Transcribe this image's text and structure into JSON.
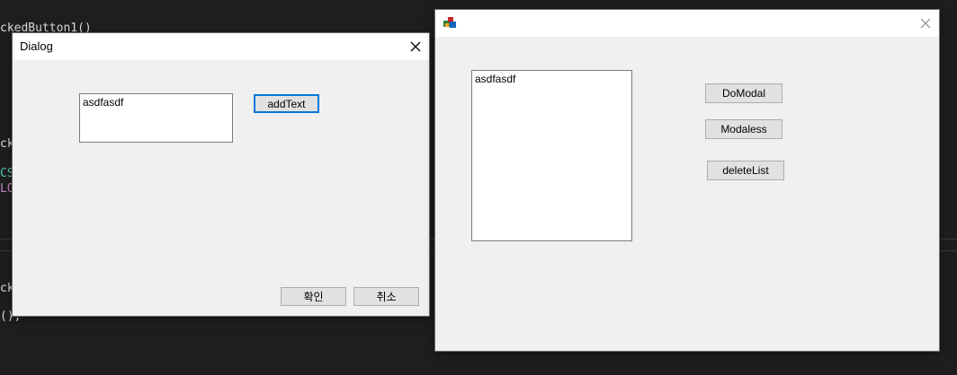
{
  "background_code": {
    "line1": "ckedButton1()",
    "line2": "ck",
    "line3": "CS",
    "line4": "LO",
    "line5": "ck",
    "line6": "();"
  },
  "dialog": {
    "title": "Dialog",
    "edit_value": "asdfasdf",
    "add_text_label": "addText",
    "ok_label": "확인",
    "cancel_label": "취소"
  },
  "main_window": {
    "title": "",
    "list_items": [
      "asdfasdf"
    ],
    "domodal_label": "DoModal",
    "modaless_label": "Modaless",
    "delete_list_label": "deleteList"
  }
}
